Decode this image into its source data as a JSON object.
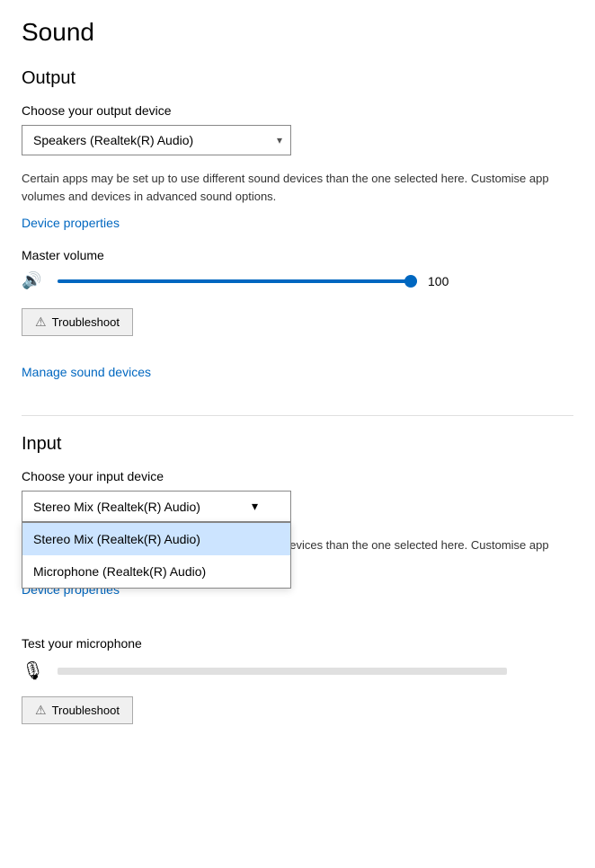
{
  "page": {
    "title": "Sound"
  },
  "output": {
    "section_title": "Output",
    "choose_device_label": "Choose your output device",
    "selected_device": "Speakers (Realtek(R) Audio)",
    "info_text": "Certain apps may be set up to use different sound devices than the one selected here. Customise app volumes and devices in advanced sound options.",
    "device_properties_link": "Device properties",
    "master_volume_label": "Master volume",
    "volume_value": "100",
    "troubleshoot_label": "Troubleshoot",
    "manage_sound_devices_link": "Manage sound devices"
  },
  "input": {
    "section_title": "Input",
    "choose_device_label": "Choose your input device",
    "dropdown_options": [
      {
        "label": "Stereo Mix (Realtek(R) Audio)",
        "selected": true
      },
      {
        "label": "Microphone (Realtek(R) Audio)",
        "selected": false
      }
    ],
    "info_text": "Certain apps may be set up to use different sound devices than the one selected here. Customise app volumes and devices in advanced sound options.",
    "device_properties_link": "Device properties",
    "test_mic_label": "Test your microphone",
    "troubleshoot_label": "Troubleshoot"
  },
  "icons": {
    "volume": "🔊",
    "microphone": "🎙",
    "warning": "⚠",
    "chevron_down": "▾"
  }
}
